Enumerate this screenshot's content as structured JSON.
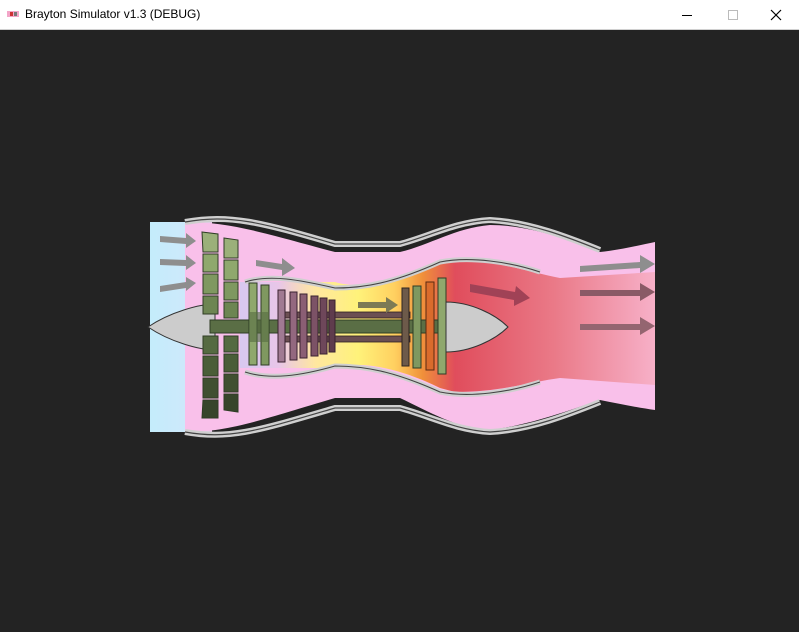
{
  "window": {
    "title": "Brayton Simulator v1.3 (DEBUG)",
    "controls": [
      "minimize",
      "maximize",
      "close"
    ]
  },
  "icons": {
    "app": "engine-app-icon",
    "minimize": "minimize-icon",
    "maximize": "maximize-icon",
    "close": "close-icon"
  },
  "colors": {
    "background": "#232323",
    "titlebar": "#ffffff",
    "casing_fill": "#f9c0ea",
    "casing_outline": "#cfcfcf",
    "intake_air": "#c7ecfb",
    "blade_green": "#8fab6e",
    "blade_dark": "#3d5033",
    "combustor_yellow": "#fff080",
    "exhaust_red": "#e04d5c",
    "spinner_gray": "#cccccc",
    "arrow_gray": "#888888"
  },
  "scene": {
    "name": "turbojet-brayton-cycle",
    "sections": [
      "intake",
      "fan",
      "compressor",
      "combustor",
      "turbine",
      "exhaust-nozzle"
    ]
  }
}
